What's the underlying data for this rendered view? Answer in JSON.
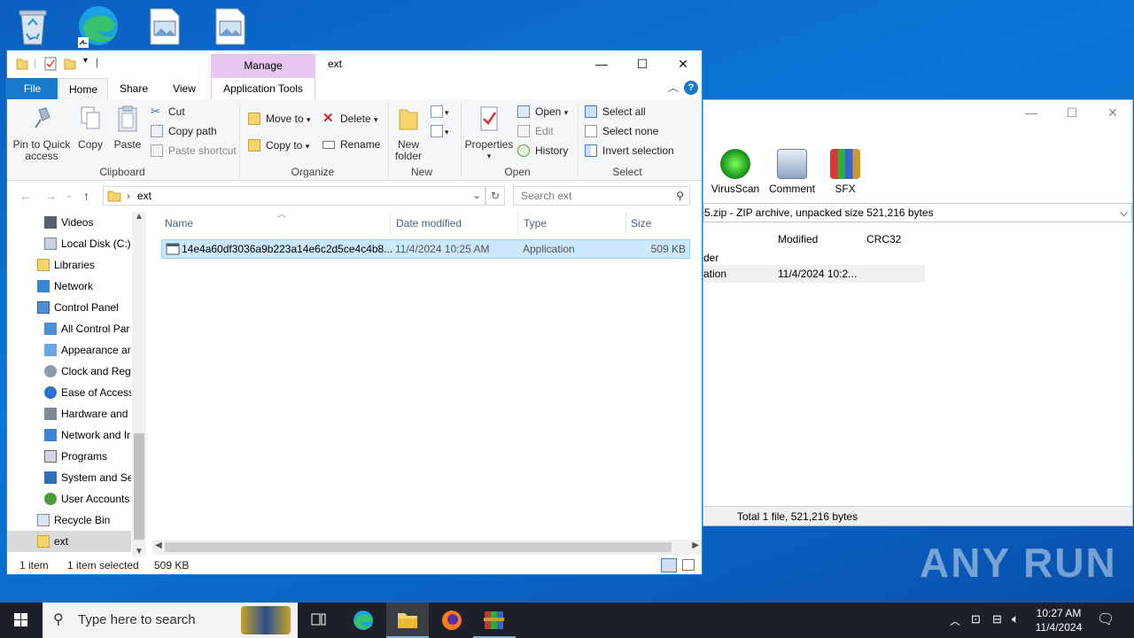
{
  "desktop": {
    "icons": [
      "recycle-bin",
      "edge",
      "image-file",
      "image-file"
    ]
  },
  "winrar": {
    "tools": [
      "VirusScan",
      "Comment",
      "SFX"
    ],
    "path": "5.zip - ZIP archive, unpacked size 521,216 bytes",
    "columns": [
      "Modified",
      "CRC32"
    ],
    "rows": [
      {
        "name": "der",
        "modified": ""
      },
      {
        "name": "ation",
        "modified": "11/4/2024 10:2..."
      }
    ],
    "status": "Total 1 file, 521,216 bytes"
  },
  "explorer": {
    "manage": "Manage",
    "title": "ext",
    "tabs": {
      "file": "File",
      "home": "Home",
      "share": "Share",
      "view": "View",
      "app_tools": "Application Tools"
    },
    "ribbon": {
      "pin_l1": "Pin to Quick",
      "pin_l2": "access",
      "copy": "Copy",
      "paste": "Paste",
      "cut": "Cut",
      "copy_path": "Copy path",
      "paste_shortcut": "Paste shortcut",
      "clipboard": "Clipboard",
      "move_to": "Move to",
      "copy_to": "Copy to",
      "delete": "Delete",
      "rename": "Rename",
      "organize": "Organize",
      "new_folder_l1": "New",
      "new_folder_l2": "folder",
      "new": "New",
      "properties": "Properties",
      "open": "Open",
      "edit": "Edit",
      "history": "History",
      "open_group": "Open",
      "select_all": "Select all",
      "select_none": "Select none",
      "invert_selection": "Invert selection",
      "select": "Select"
    },
    "address": "ext",
    "search_placeholder": "Search ext",
    "nav": [
      "Videos",
      "Local Disk (C:)",
      "Libraries",
      "Network",
      "Control Panel",
      "All Control Par",
      "Appearance an",
      "Clock and Regi",
      "Ease of Access",
      "Hardware and",
      "Network and Ir",
      "Programs",
      "System and Se",
      "User Accounts",
      "Recycle Bin",
      "ext"
    ],
    "columns": {
      "name": "Name",
      "date": "Date modified",
      "type": "Type",
      "size": "Size"
    },
    "file": {
      "name": "14e4a60df3036a9b223a14e6c2d5ce4c4b8...",
      "date": "11/4/2024 10:25 AM",
      "type": "Application",
      "size": "509 KB"
    },
    "status": {
      "count": "1 item",
      "selected": "1 item selected",
      "size": "509 KB"
    }
  },
  "taskbar": {
    "search": "Type here to search",
    "time": "10:27 AM",
    "date": "11/4/2024"
  },
  "watermark": "ANY RUN"
}
